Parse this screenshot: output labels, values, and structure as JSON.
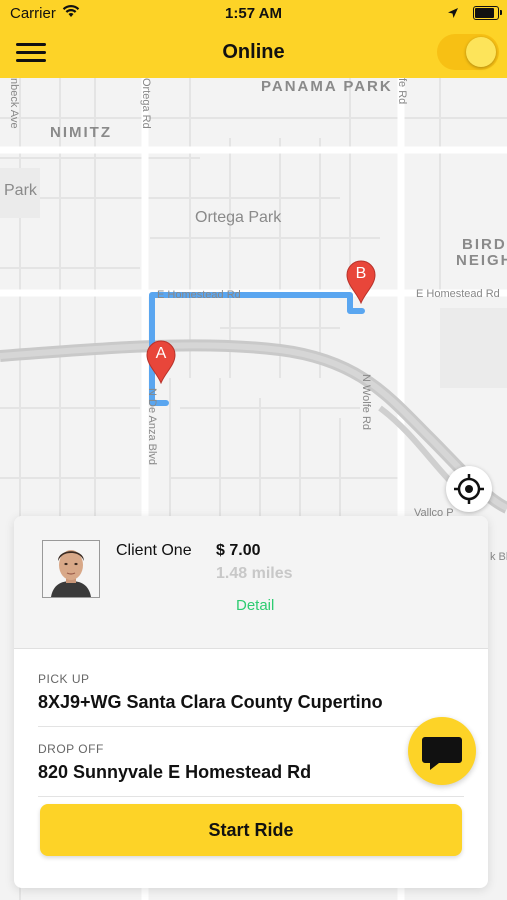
{
  "status_bar": {
    "carrier": "Carrier",
    "time": "1:57 AM"
  },
  "nav": {
    "title": "Online",
    "online_toggle_on": true
  },
  "map": {
    "labels": {
      "panama_park": "PANAMA PARK",
      "nimitz": "NIMITZ",
      "park": "Park",
      "ortega_park": "Ortega Park",
      "birdl": "BIRDL",
      "neigh": "NEIGH",
      "e_homestead_rd": "E Homestead Rd",
      "e_homestead_rd_2": "E Homestead Rd",
      "n_wolfe_rd": "N Wolfe Rd",
      "n_de_anza_blvd": "N De Anza Blvd",
      "ortega_rd": "Ortega Rd",
      "nbeck_ave": "nbeck Ave",
      "fe_rd": "fe Rd",
      "vallco": "Vallco P",
      "k_blv": "k Blv"
    },
    "marker_a": "A",
    "marker_b": "B",
    "route_color": "#5aa6f0",
    "marker_color": "#e8463a"
  },
  "ride": {
    "client_name": "Client One",
    "fare": "$ 7.00",
    "distance": "1.48 miles",
    "detail_label": "Detail",
    "pickup_label": "PICK UP",
    "pickup_address": "8XJ9+WG Santa Clara County Cupertino",
    "dropoff_label": "DROP OFF",
    "dropoff_address": "820 Sunnyvale E Homestead Rd",
    "start_button": "Start Ride"
  },
  "icons": {
    "menu": "hamburger-menu-icon",
    "locate": "crosshair-icon",
    "chat": "chat-bubble-icon",
    "wifi": "wifi-icon",
    "location": "location-arrow-icon",
    "battery": "battery-icon"
  },
  "colors": {
    "accent": "#fdd327",
    "detail": "#2ecc71"
  }
}
